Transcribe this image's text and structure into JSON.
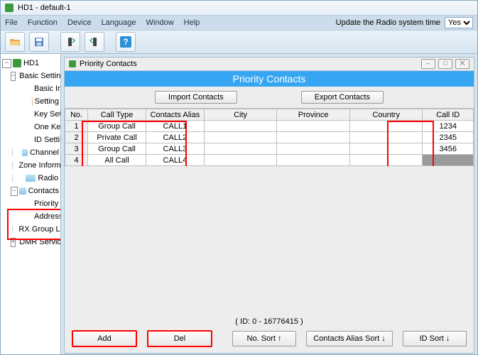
{
  "window": {
    "title": "HD1  -  default-1"
  },
  "menu": {
    "items": [
      "File",
      "Function",
      "Device",
      "Language",
      "Window",
      "Help"
    ],
    "update_label": "Update the Radio system time",
    "update_value": "Yes"
  },
  "tree": {
    "root": "HD1",
    "basic_setting": "Basic Setting",
    "basic_children": [
      "Basic Information",
      "Setting",
      "Key Setting",
      "One Key Call",
      "ID Setting"
    ],
    "channel": "Channel",
    "zone": "Zone Information",
    "radio": "Radio",
    "contacts": "Contacts",
    "contacts_children": [
      "Priority Contacts",
      "Address Book Co"
    ],
    "rx": "RX Group Lists",
    "dmr": "DMR Service"
  },
  "panel": {
    "title": "Priority Contacts",
    "header": "Priority Contacts",
    "import_btn": "Import Contacts",
    "export_btn": "Export Contacts",
    "columns": [
      "No.",
      "Call Type",
      "Contacts Alias",
      "City",
      "Province",
      "Country",
      "Call ID"
    ],
    "rows": [
      {
        "no": "1",
        "type": "Group Call",
        "alias": "CALL1",
        "city": "",
        "prov": "",
        "country": "",
        "cid": "1234"
      },
      {
        "no": "2",
        "type": "Private Call",
        "alias": "CALL2",
        "city": "",
        "prov": "",
        "country": "",
        "cid": "2345"
      },
      {
        "no": "3",
        "type": "Group Call",
        "alias": "CALL3",
        "city": "",
        "prov": "",
        "country": "",
        "cid": "3456"
      },
      {
        "no": "4",
        "type": "All Call",
        "alias": "CALL4",
        "city": "",
        "prov": "",
        "country": "",
        "cid": ""
      }
    ],
    "id_range": "( ID: 0 - 16776415 )",
    "footer_btns": {
      "add": "Add",
      "del": "Del",
      "nosort": "No. Sort ↑",
      "aliassort": "Contacts Alias Sort ↓",
      "idsort": "ID Sort ↓"
    }
  }
}
